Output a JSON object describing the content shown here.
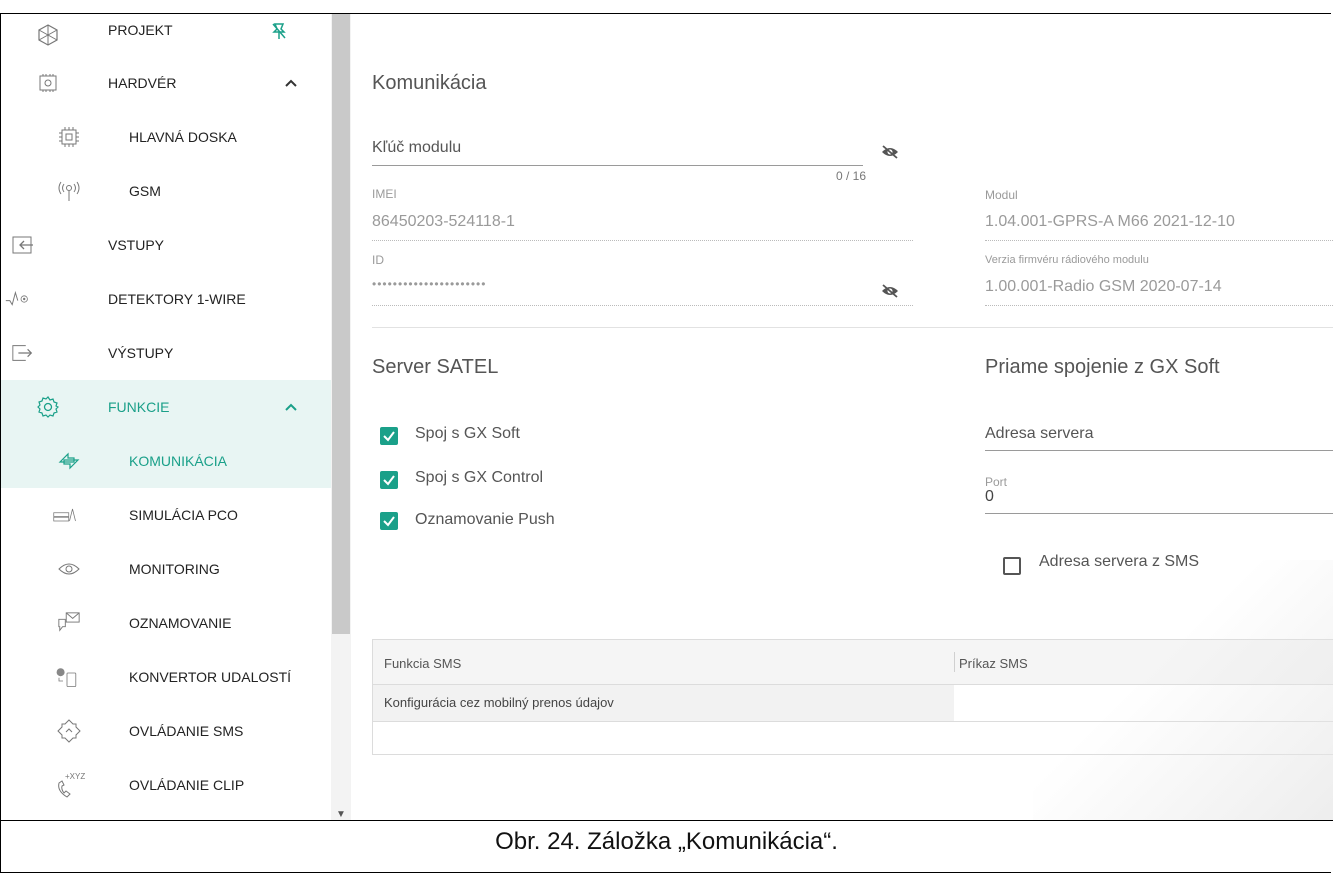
{
  "sidebar": {
    "items": [
      {
        "label": "PROJEKT",
        "icon": "project-icon"
      },
      {
        "label": "HARDVÉR",
        "icon": "hardware-icon"
      },
      {
        "label": "HLAVNÁ DOSKA",
        "icon": "mainboard-icon"
      },
      {
        "label": "GSM",
        "icon": "gsm-antenna-icon"
      },
      {
        "label": "VSTUPY",
        "icon": "input-icon"
      },
      {
        "label": "DETEKTORY 1-WIRE",
        "icon": "one-wire-icon"
      },
      {
        "label": "VÝSTUPY",
        "icon": "output-icon"
      },
      {
        "label": "FUNKCIE",
        "icon": "gear-icon"
      },
      {
        "label": "KOMUNIKÁCIA",
        "icon": "communication-icon"
      },
      {
        "label": "SIMULÁCIA PCO",
        "icon": "pco-icon"
      },
      {
        "label": "MONITORING",
        "icon": "eye-icon"
      },
      {
        "label": "OZNAMOVANIE",
        "icon": "notification-icon"
      },
      {
        "label": "KONVERTOR UDALOSTÍ",
        "icon": "converter-icon"
      },
      {
        "label": "OVLÁDANIE SMS",
        "icon": "sms-control-icon"
      },
      {
        "label": "OVLÁDANIE CLIP",
        "icon": "clip-control-icon"
      }
    ],
    "clip_icon_text": "+XYZ"
  },
  "main": {
    "title": "Komunikácia",
    "module_key": {
      "placeholder": "Kľúč modulu",
      "counter": "0 / 16"
    },
    "imei": {
      "label": "IMEI",
      "value": "86450203-524118-1"
    },
    "id": {
      "label": "ID",
      "value": "••••••••••••••••••••••"
    },
    "modul": {
      "label": "Modul",
      "value": "1.04.001-GPRS-A M66 2021-12-10"
    },
    "radio_fw": {
      "label": "Verzia firmvéru rádiového modulu",
      "value": "1.00.001-Radio GSM 2020-07-14"
    },
    "server_title": "Server SATEL",
    "checks": [
      {
        "label": "Spoj s GX Soft",
        "checked": true
      },
      {
        "label": "Spoj s GX Control",
        "checked": true
      },
      {
        "label": "Oznamovanie Push",
        "checked": true
      }
    ],
    "direct_title": "Priame spojenie z GX Soft",
    "server_address": "Adresa servera",
    "port": {
      "label": "Port",
      "value": "0"
    },
    "sms_check": {
      "label": "Adresa servera z SMS",
      "checked": false
    },
    "table": {
      "headers": [
        "Funkcia SMS",
        "Príkaz SMS"
      ],
      "rows": [
        [
          "Konfigurácia cez mobilný prenos údajov",
          ""
        ]
      ]
    }
  },
  "caption": "Obr. 24. Záložka „Komunikácia“.",
  "colors": {
    "accent": "#1aa089",
    "active_bg": "#e8f5f3"
  }
}
